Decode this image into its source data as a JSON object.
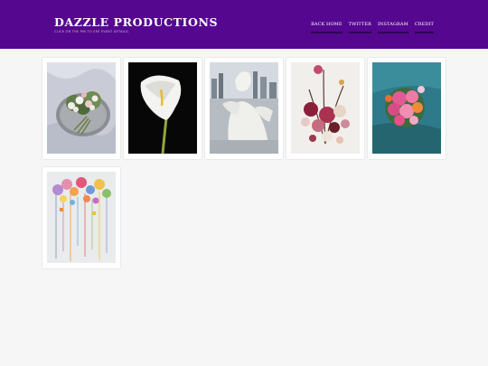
{
  "header": {
    "title": "DAZZLE PRODUCTIONS",
    "tagline": "CLICK ON THE PIN TO SEE EVENT DETAILS.",
    "background": "#55088f"
  },
  "nav": {
    "items": [
      {
        "label": "BACK HOME"
      },
      {
        "label": "TWITTER"
      },
      {
        "label": "INSTAGRAM"
      },
      {
        "label": "CREDIT"
      }
    ]
  },
  "pins": [
    {
      "subject": "bouquet-on-silver-tray-photo"
    },
    {
      "subject": "calla-lily-photo"
    },
    {
      "subject": "white-sculpture-city-photo"
    },
    {
      "subject": "floral-arrangement-photo"
    },
    {
      "subject": "pink-rose-bouquet-photo"
    },
    {
      "subject": "dripping-flowers-painting"
    }
  ]
}
